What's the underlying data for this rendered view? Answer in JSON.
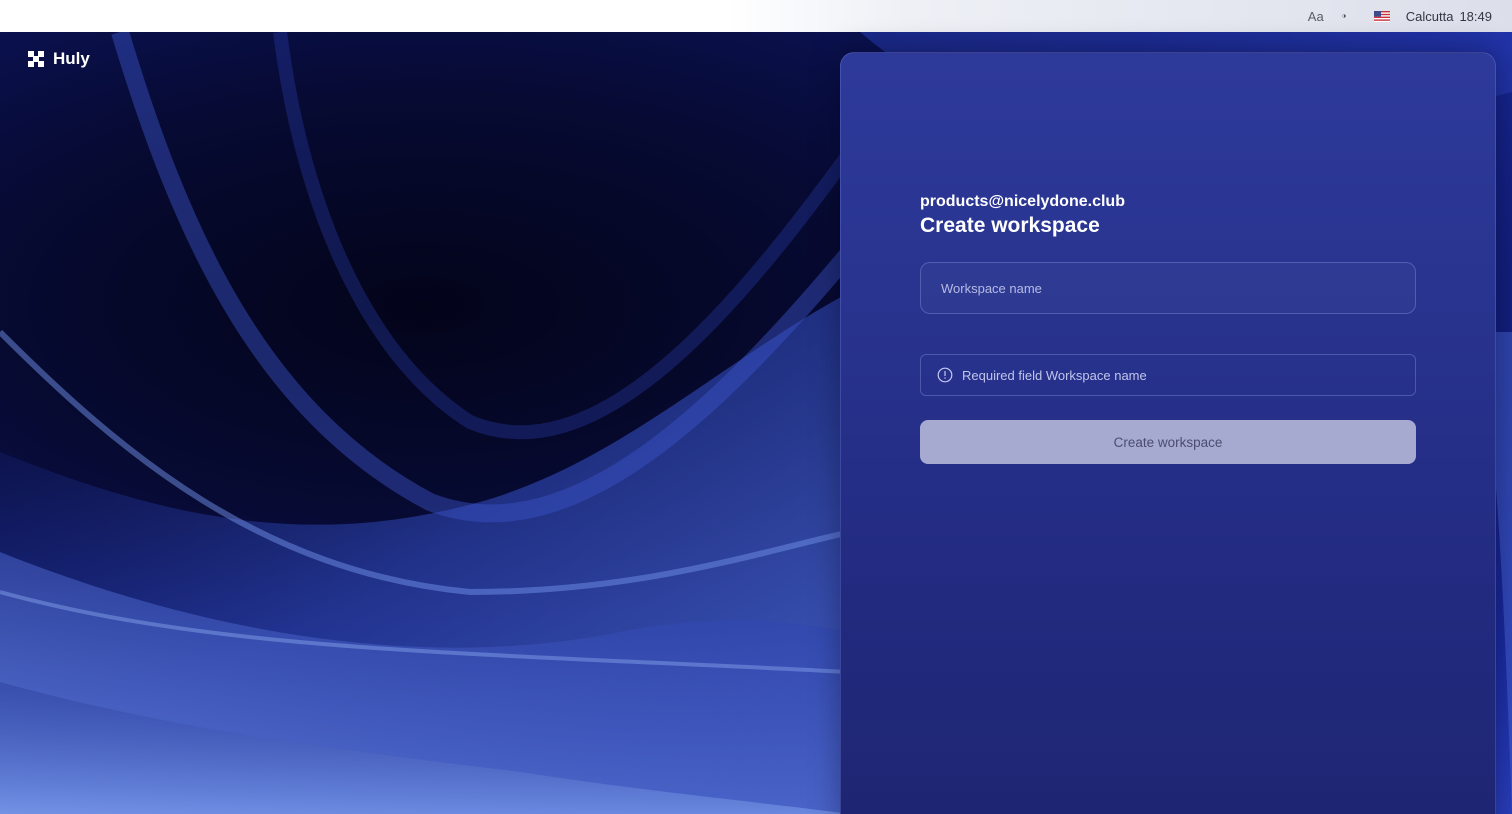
{
  "topbar": {
    "font_label": "Aa",
    "theme_icon": "contrast-icon",
    "flag_icon": "us-flag-icon",
    "city": "Calcutta",
    "time": "18:49"
  },
  "logo": {
    "name": "Huly",
    "icon": "huly-logo-icon"
  },
  "form": {
    "email": "products@nicelydone.club",
    "title": "Create workspace",
    "workspace_name": {
      "value": "",
      "placeholder": "Workspace name"
    },
    "error_icon": "info-circle-icon",
    "error_text": "Required field Workspace name",
    "submit_label": "Create workspace",
    "submit_state": "disabled"
  },
  "colors": {
    "panel": "#28338e",
    "button_disabled": "#a6a9d0",
    "button_text": "#4a4e6e",
    "topbar": "#ffffff"
  }
}
